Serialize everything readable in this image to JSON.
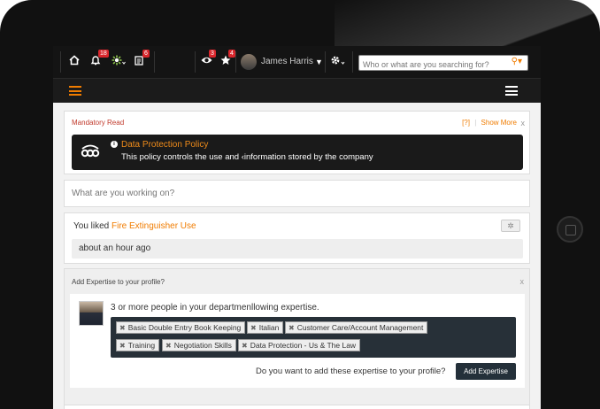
{
  "topbar": {
    "home_icon": "home-icon",
    "notifications_badge": "18",
    "apps_icon": "gear-flower-icon",
    "tasks_badge": "6",
    "watch_badge": "3",
    "favorites_badge": "4",
    "user_name": "James Harris",
    "search_placeholder": "Who or what are you searching for?"
  },
  "colors": {
    "accent": "#f07c00",
    "dark": "#141414",
    "badge": "#d9262c"
  },
  "mandatory": {
    "title": "Mandatory Read",
    "help_link": "[?]",
    "divider": "|",
    "show_more": "Show More",
    "close": "x",
    "policy_title": "Data Protection Policy",
    "policy_text": "This policy controls the use and ‹information stored by the company"
  },
  "status": {
    "placeholder": "What are you working on?"
  },
  "activity": {
    "prefix": "You liked ",
    "link": "Fire Extinguisher Use",
    "time": "about an hour ago"
  },
  "expertise": {
    "heading": "Add Expertise to your profile?",
    "close": "x",
    "message": "3 or more people in your departmenllowing expertise.",
    "tags": [
      "Basic Double Entry Book Keeping",
      "Italian",
      "Customer Care/Account Management",
      "Training",
      "Negotiation Skills",
      "Data Protection - Us & The Law"
    ],
    "question": "Do you want to add these expertise to your profile?",
    "add_button": "Add Expertise"
  }
}
